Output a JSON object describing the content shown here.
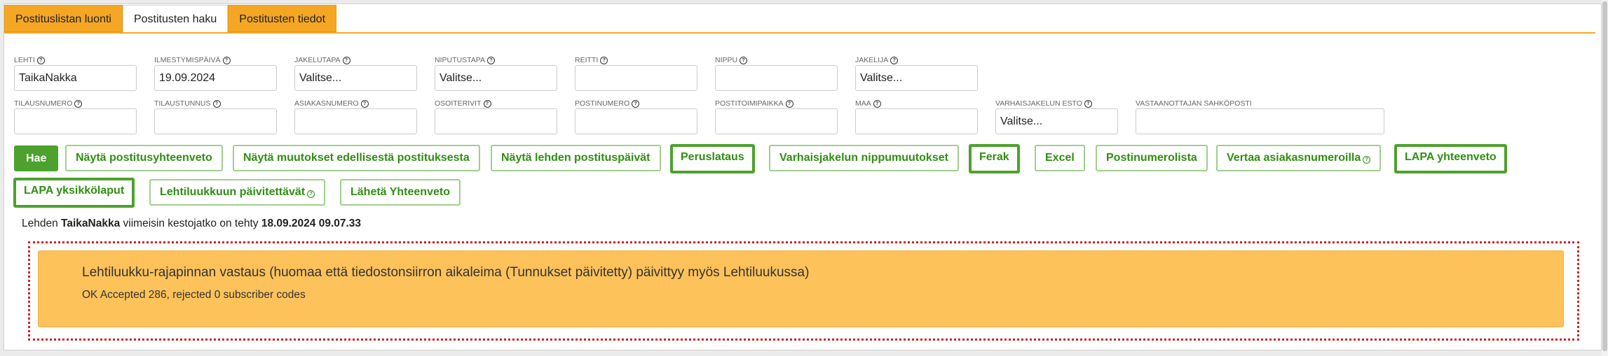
{
  "tabs": [
    {
      "label": "Postituslistan luonti"
    },
    {
      "label": "Postitusten haku"
    },
    {
      "label": "Postitusten tiedot"
    }
  ],
  "fields_row1": [
    {
      "label": "LEHTI",
      "value": "TaikaNakka"
    },
    {
      "label": "ILMESTYMISPÄIVÄ",
      "value": "19.09.2024"
    },
    {
      "label": "JAKELUTAPA",
      "value": "Valitse..."
    },
    {
      "label": "NIPUTUSTAPA",
      "value": "Valitse..."
    },
    {
      "label": "REITTI",
      "value": ""
    },
    {
      "label": "NIPPU",
      "value": ""
    },
    {
      "label": "JAKELIJA",
      "value": "Valitse..."
    }
  ],
  "fields_row2": [
    {
      "label": "TILAUSNUMERO",
      "value": ""
    },
    {
      "label": "TILAUSTUNNUS",
      "value": ""
    },
    {
      "label": "ASIAKASNUMERO",
      "value": ""
    },
    {
      "label": "OSOITERIVIT",
      "value": ""
    },
    {
      "label": "POSTINUMERO",
      "value": ""
    },
    {
      "label": "POSTITOIMIPAIKKA",
      "value": ""
    },
    {
      "label": "MAA",
      "value": ""
    },
    {
      "label": "VARHAISJAKELUN ESTO",
      "value": "Valitse..."
    },
    {
      "label": "VASTAANOTTAJAN SAHKÖPOSTI",
      "value": ""
    }
  ],
  "buttons": {
    "hae": "Hae",
    "nayta_postitusyhteenveto": "Näytä postitusyhteenveto",
    "nayta_muutokset": "Näytä muutokset edellisestä postituksesta",
    "nayta_postituspaivat": "Näytä lehden postituspäivät",
    "peruslataus": "Peruslataus",
    "varhaisjakelun_nippumuutokset": "Varhaisjakelun nippumuutokset",
    "ferak": "Ferak",
    "excel": "Excel",
    "postinumerolista": "Postinumerolista",
    "vertaa_asiakasnumeroilla": "Vertaa asiakasnumeroilla",
    "lapa_yhteenveto": "LAPA yhteenveto",
    "lapa_yksikkolaput": "LAPA yksikkölaput",
    "lehtiluukkuun_paivitettavat": "Lehtiluukkuun päivitettävät",
    "laheta_yhteenveto": "Lähetä Yhteenveto"
  },
  "status": {
    "prefix": "Lehden",
    "paper": "TaikaNakka",
    "middle": "viimeisin kestojatko on tehty",
    "datetime": "18.09.2024 09.07.33"
  },
  "alert": {
    "title": "Lehtiluukku-rajapinnan vastaus (huomaa että tiedostonsiirron aikaleima (Tunnukset päivitetty) päivittyy myös Lehtiluukussa)",
    "message": "OK Accepted 286, rejected 0 subscriber codes"
  },
  "help_glyph": "?",
  "colors": {
    "tab_orange": "#f5a623",
    "button_green": "#4ca22c",
    "alert_bg": "#fdc25a",
    "dashed_red": "#d42020"
  }
}
